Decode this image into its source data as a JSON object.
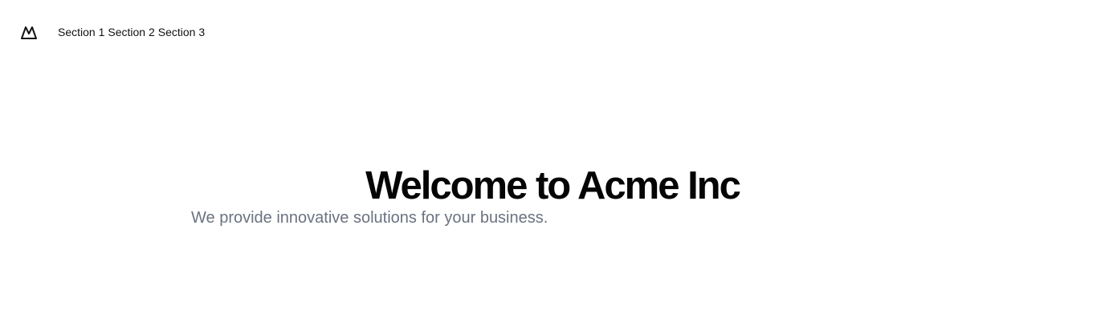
{
  "header": {
    "logo_icon": "mountain-icon",
    "nav": [
      {
        "label": "Section 1"
      },
      {
        "label": "Section 2"
      },
      {
        "label": "Section 3"
      }
    ]
  },
  "hero": {
    "title": "Welcome to Acme Inc",
    "subtitle": "We provide innovative solutions for your business."
  },
  "colors": {
    "background": "#ffffff",
    "title": "#050505",
    "subtitle": "#6b7280",
    "nav_text": "#111111"
  }
}
